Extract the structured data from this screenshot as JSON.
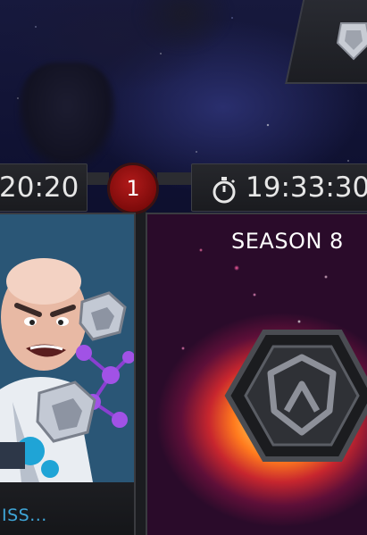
{
  "timers": {
    "left": "20:20",
    "right": "19:33:30"
  },
  "notification": {
    "count": "1"
  },
  "cards": {
    "left_caption": "ISS...",
    "right_title": "SEASON 8"
  },
  "icons": {
    "corner": "game-mode-icon",
    "stopwatch": "stopwatch-icon",
    "league": "league-shield-icon"
  },
  "colors": {
    "badge_red": "#9e1212",
    "caption_blue": "#3fa6d8",
    "panel_dark": "#1d1e22"
  }
}
